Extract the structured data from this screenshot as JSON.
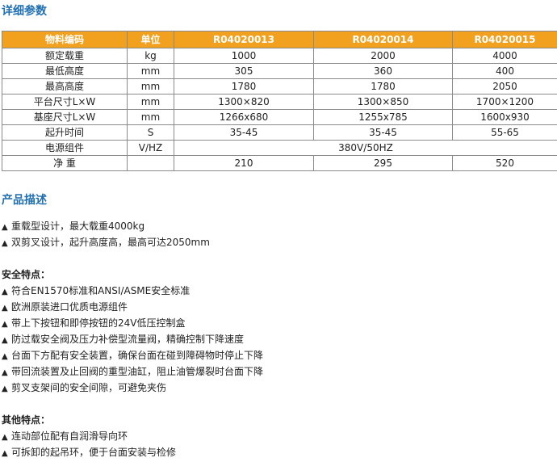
{
  "params": {
    "title": "详细参数",
    "headers": [
      "物料编码",
      "单位",
      "R04020013",
      "R04020014",
      "R04020015"
    ],
    "rows": [
      {
        "name": "额定载重",
        "unit": "kg",
        "v1": "1000",
        "v2": "2000",
        "v3": "4000"
      },
      {
        "name": "最低高度",
        "unit": "mm",
        "v1": "305",
        "v2": "360",
        "v3": "400"
      },
      {
        "name": "最高高度",
        "unit": "mm",
        "v1": "1780",
        "v2": "1780",
        "v3": "2050"
      },
      {
        "name": "平台尺寸L×W",
        "unit": "mm",
        "v1": "1300×820",
        "v2": "1300×850",
        "v3": "1700×1200"
      },
      {
        "name": "基座尺寸L×W",
        "unit": "mm",
        "v1": "1266x680",
        "v2": "1255x785",
        "v3": "1600x930"
      },
      {
        "name": "起升时间",
        "unit": "S",
        "v1": "35-45",
        "v2": "35-45",
        "v3": "55-65"
      }
    ],
    "power_row": {
      "name": "电源组件",
      "unit": "V/HZ",
      "value": "380V/50HZ"
    },
    "weight_row": {
      "name": "净 重",
      "unit": "",
      "v1": "210",
      "v2": "295",
      "v3": "520"
    }
  },
  "description": {
    "title": "产品描述",
    "items": [
      "重载型设计，最大载重4000kg",
      "双剪叉设计，起升高度高，最高可达2050mm"
    ]
  },
  "safety": {
    "title": "安全特点：",
    "items": [
      "符合EN1570标准和ANSI/ASME安全标准",
      "欧洲原装进口优质电源组件",
      "带上下按钮和即停按钮的24V低压控制盒",
      "防过载安全阀及压力补偿型流量阀，精确控制下降速度",
      "台面下方配有安全装置，确保台面在碰到障碍物时停止下降",
      "带回流装置及止回阀的重型油缸，阻止油管爆裂时台面下降",
      "剪叉支架间的安全间隙，可避免夹伤"
    ]
  },
  "other": {
    "title": "其他特点：",
    "items": [
      "连动部位配有自润滑导向环",
      "可拆卸的起吊环，便于台面安装与检修"
    ]
  },
  "bullet_symbol": "▲"
}
